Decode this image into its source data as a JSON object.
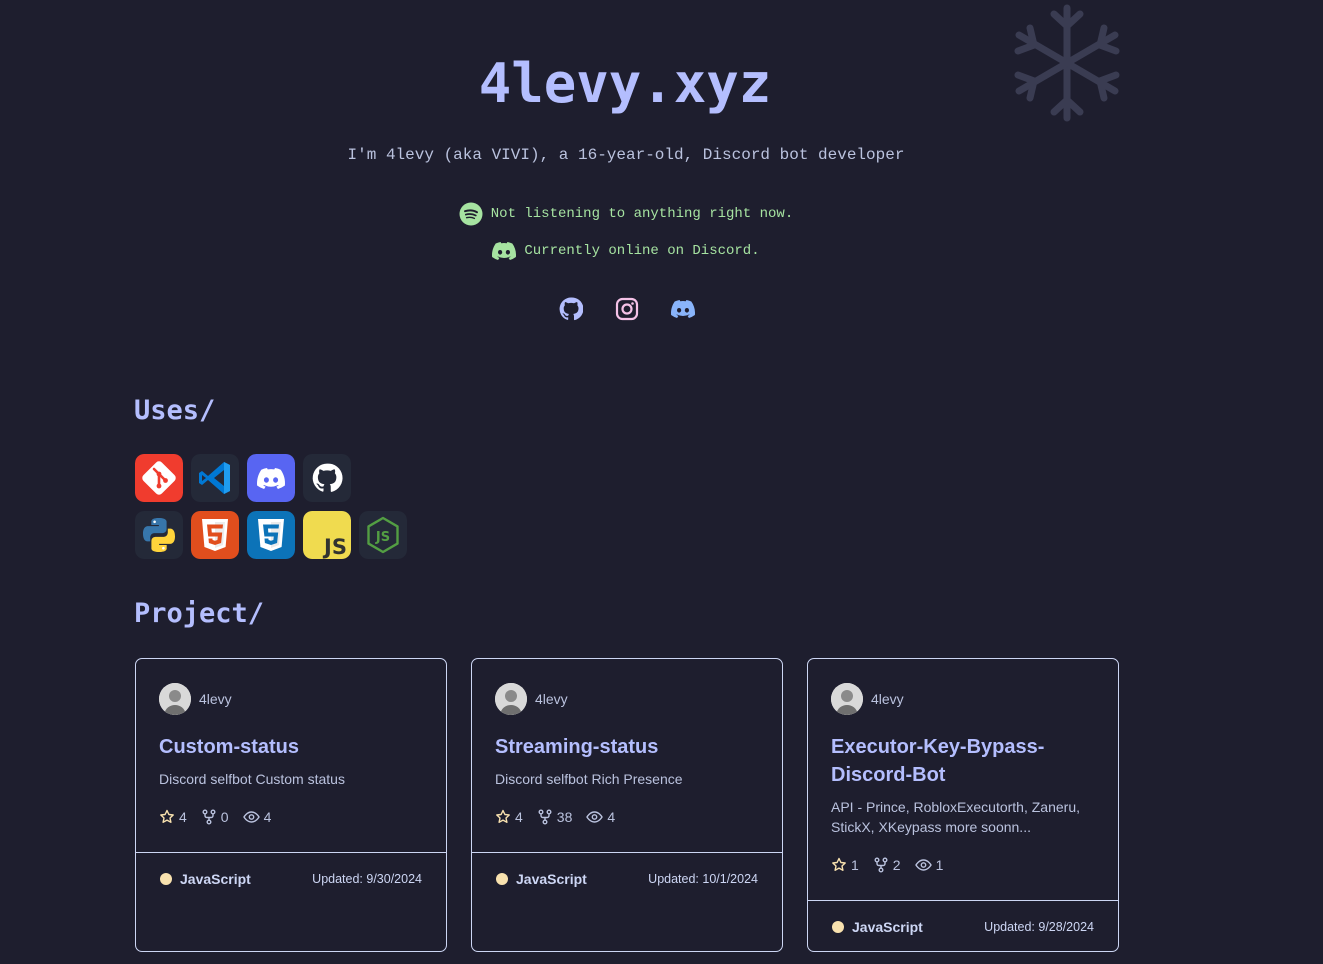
{
  "site": {
    "title": "4levy.xyz",
    "subtitle": "I'm 4levy (aka VIVI), a 16-year-old, Discord bot developer",
    "spotify_status": "Not listening to anything right now.",
    "discord_status": "Currently online on Discord."
  },
  "socials": [
    {
      "icon": "github-icon"
    },
    {
      "icon": "instagram-icon"
    },
    {
      "icon": "discord-icon"
    }
  ],
  "uses": {
    "heading": "Uses/",
    "row1": [
      "git-icon",
      "vscode-icon",
      "discord-icon",
      "github-icon"
    ],
    "row2": [
      "python-icon",
      "html5-icon",
      "css3-icon",
      "javascript-icon",
      "nodejs-icon"
    ]
  },
  "projects": {
    "heading": "Project/",
    "cards": [
      {
        "owner": "4levy",
        "name": "Custom-status",
        "description": "Discord selfbot Custom status",
        "stars": "4",
        "forks": "0",
        "watchers": "4",
        "language": "JavaScript",
        "updated": "Updated: 9/30/2024"
      },
      {
        "owner": "4levy",
        "name": "Streaming-status",
        "description": "Discord selfbot Rich Presence",
        "stars": "4",
        "forks": "38",
        "watchers": "4",
        "language": "JavaScript",
        "updated": "Updated: 10/1/2024"
      },
      {
        "owner": "4levy",
        "name": "Executor-Key-Bypass-Discord-Bot",
        "description": "API - Prince, RobloxExecutorth, Zaneru, StickX, XKeypass more soonn...",
        "stars": "1",
        "forks": "2",
        "watchers": "1",
        "language": "JavaScript",
        "updated": "Updated: 9/28/2024"
      }
    ]
  },
  "colors": {
    "background": "#1e1e2e",
    "accent": "#b4befe",
    "status_green": "#a6e3a1",
    "language_dot": "#f9e2af"
  }
}
